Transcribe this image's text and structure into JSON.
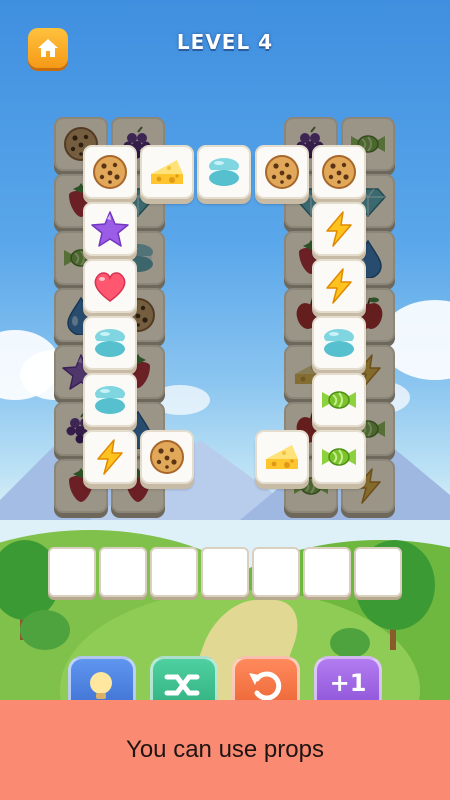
{
  "header": {
    "level_text": "LEVEL 4",
    "home_icon": "home-icon"
  },
  "board": {
    "bottom_layer": [
      [
        "cookie",
        "grapes",
        "grapes",
        "candy"
      ],
      [
        "strawberry",
        "diamond",
        "diamond",
        "diamond"
      ],
      [
        "candy",
        "macaron",
        "strawberry",
        "water-drop"
      ],
      [
        "water-drop",
        "cookie",
        "apple",
        "apple"
      ],
      [
        "star",
        "strawberry",
        "cheese",
        "lightning"
      ],
      [
        "grapes",
        "water-drop",
        "apple",
        "candy"
      ],
      [
        "strawberry",
        "strawberry",
        "candy",
        "lightning"
      ]
    ],
    "top_layer": {
      "row1": [
        "cookie",
        "cheese",
        "macaron",
        "cookie",
        "cookie"
      ],
      "left_column": [
        "star",
        "heart",
        "macaron",
        "macaron",
        "lightning"
      ],
      "right_column": [
        "lightning",
        "lightning",
        "macaron",
        "candy",
        "candy"
      ],
      "bottom_extra": [
        "cookie",
        "cheese"
      ]
    }
  },
  "tray": {
    "slot_count": 7,
    "filled": []
  },
  "props": [
    "hint-bulb-icon",
    "shuffle-icon",
    "undo-icon",
    "add-slot-icon"
  ],
  "props_labels": {
    "add_slot": "+1"
  },
  "banner": {
    "text": "You can use props"
  },
  "colors": {
    "banner": "#fb8a72",
    "home_button": "#f59a17",
    "sky": "#5aa7ea"
  }
}
